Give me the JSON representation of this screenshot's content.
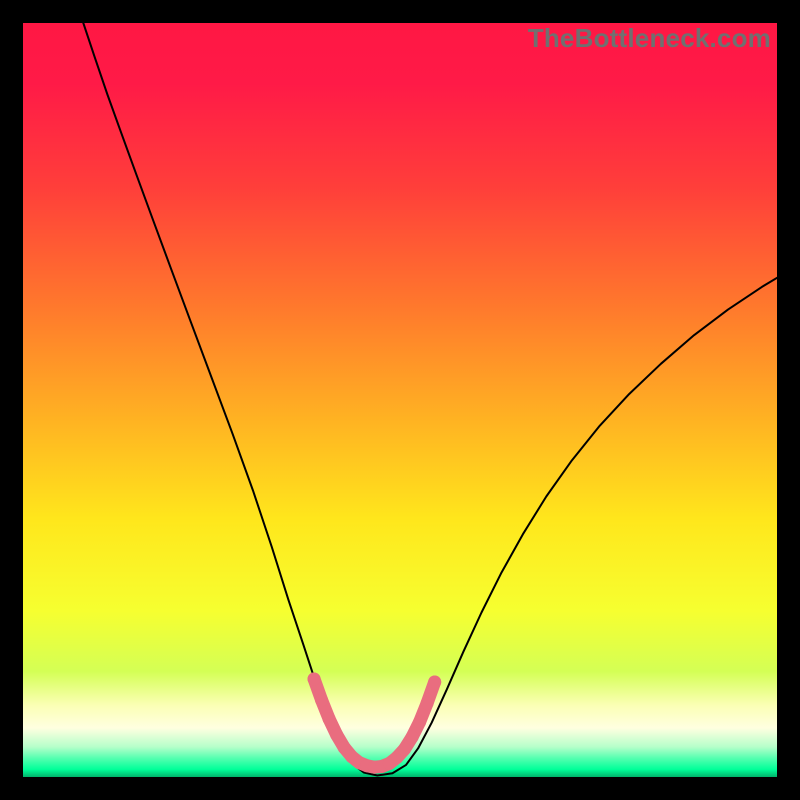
{
  "watermark": "TheBottleneck.com",
  "chart_data": {
    "type": "line",
    "title": "",
    "xlabel": "",
    "ylabel": "",
    "xlim": [
      0,
      1
    ],
    "ylim": [
      0,
      1
    ],
    "gradient_stops": [
      {
        "offset": 0.0,
        "color": "#ff1744"
      },
      {
        "offset": 0.08,
        "color": "#ff1a47"
      },
      {
        "offset": 0.22,
        "color": "#ff3f3a"
      },
      {
        "offset": 0.38,
        "color": "#ff7a2c"
      },
      {
        "offset": 0.53,
        "color": "#ffb422"
      },
      {
        "offset": 0.66,
        "color": "#ffe71c"
      },
      {
        "offset": 0.78,
        "color": "#f6ff30"
      },
      {
        "offset": 0.86,
        "color": "#d4ff55"
      },
      {
        "offset": 0.905,
        "color": "#fbffb5"
      },
      {
        "offset": 0.935,
        "color": "#ffffe0"
      },
      {
        "offset": 0.96,
        "color": "#b6ffca"
      },
      {
        "offset": 0.975,
        "color": "#55ffb0"
      },
      {
        "offset": 0.99,
        "color": "#00ff99"
      },
      {
        "offset": 1.0,
        "color": "#00b36b"
      }
    ],
    "series": [
      {
        "name": "black-curve",
        "color": "#000000",
        "width": 2,
        "points": [
          {
            "x": 0.08,
            "y": 1.0
          },
          {
            "x": 0.095,
            "y": 0.955
          },
          {
            "x": 0.112,
            "y": 0.905
          },
          {
            "x": 0.13,
            "y": 0.855
          },
          {
            "x": 0.15,
            "y": 0.8
          },
          {
            "x": 0.172,
            "y": 0.74
          },
          {
            "x": 0.196,
            "y": 0.675
          },
          {
            "x": 0.222,
            "y": 0.605
          },
          {
            "x": 0.25,
            "y": 0.53
          },
          {
            "x": 0.278,
            "y": 0.455
          },
          {
            "x": 0.305,
            "y": 0.38
          },
          {
            "x": 0.33,
            "y": 0.305
          },
          {
            "x": 0.352,
            "y": 0.235
          },
          {
            "x": 0.372,
            "y": 0.175
          },
          {
            "x": 0.39,
            "y": 0.12
          },
          {
            "x": 0.406,
            "y": 0.075
          },
          {
            "x": 0.42,
            "y": 0.042
          },
          {
            "x": 0.436,
            "y": 0.018
          },
          {
            "x": 0.452,
            "y": 0.006
          },
          {
            "x": 0.47,
            "y": 0.002
          },
          {
            "x": 0.49,
            "y": 0.005
          },
          {
            "x": 0.508,
            "y": 0.016
          },
          {
            "x": 0.524,
            "y": 0.038
          },
          {
            "x": 0.542,
            "y": 0.072
          },
          {
            "x": 0.562,
            "y": 0.116
          },
          {
            "x": 0.584,
            "y": 0.166
          },
          {
            "x": 0.608,
            "y": 0.218
          },
          {
            "x": 0.634,
            "y": 0.27
          },
          {
            "x": 0.663,
            "y": 0.322
          },
          {
            "x": 0.694,
            "y": 0.372
          },
          {
            "x": 0.728,
            "y": 0.42
          },
          {
            "x": 0.765,
            "y": 0.466
          },
          {
            "x": 0.804,
            "y": 0.508
          },
          {
            "x": 0.846,
            "y": 0.548
          },
          {
            "x": 0.89,
            "y": 0.586
          },
          {
            "x": 0.935,
            "y": 0.62
          },
          {
            "x": 0.98,
            "y": 0.65
          },
          {
            "x": 1.0,
            "y": 0.662
          }
        ]
      },
      {
        "name": "pink-valley",
        "color": "#e96d7f",
        "width": 13,
        "points": [
          {
            "x": 0.386,
            "y": 0.13
          },
          {
            "x": 0.396,
            "y": 0.102
          },
          {
            "x": 0.406,
            "y": 0.077
          },
          {
            "x": 0.416,
            "y": 0.056
          },
          {
            "x": 0.426,
            "y": 0.039
          },
          {
            "x": 0.436,
            "y": 0.027
          },
          {
            "x": 0.446,
            "y": 0.019
          },
          {
            "x": 0.456,
            "y": 0.015
          },
          {
            "x": 0.466,
            "y": 0.013
          },
          {
            "x": 0.476,
            "y": 0.014
          },
          {
            "x": 0.486,
            "y": 0.018
          },
          {
            "x": 0.496,
            "y": 0.026
          },
          {
            "x": 0.506,
            "y": 0.037
          },
          {
            "x": 0.516,
            "y": 0.053
          },
          {
            "x": 0.526,
            "y": 0.073
          },
          {
            "x": 0.536,
            "y": 0.098
          },
          {
            "x": 0.546,
            "y": 0.126
          }
        ]
      }
    ]
  }
}
